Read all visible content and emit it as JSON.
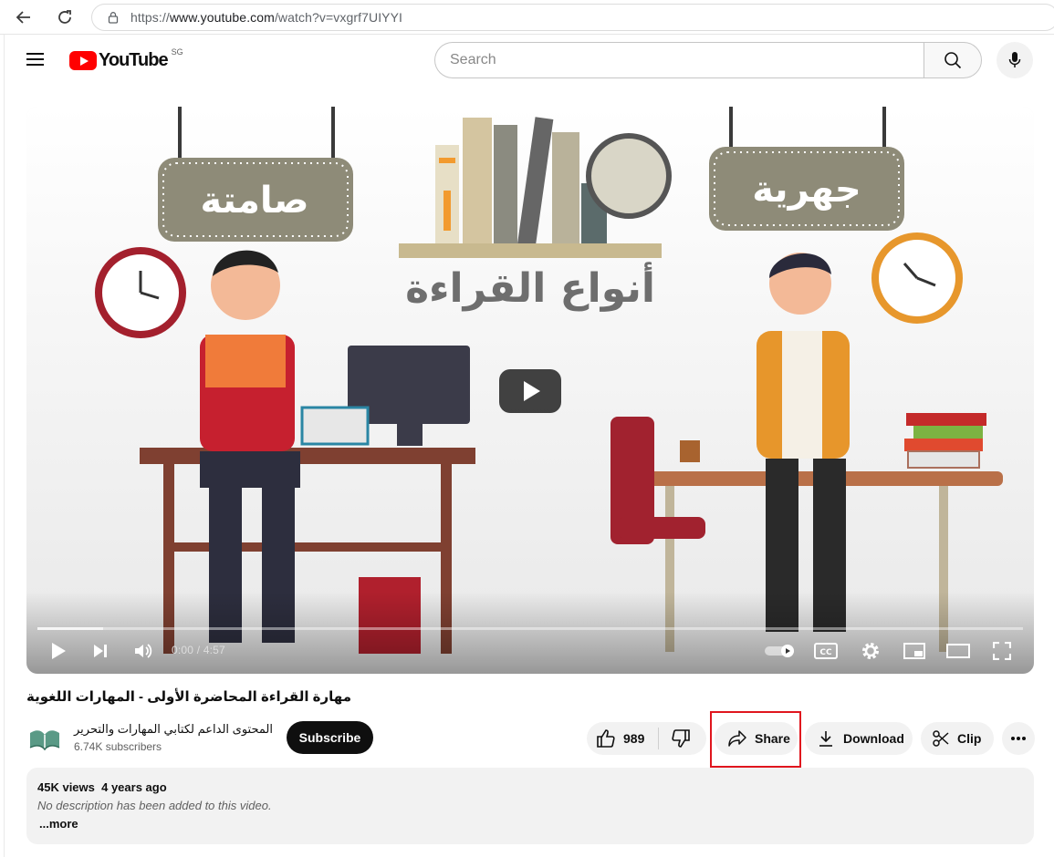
{
  "browser": {
    "url_prefix": "https://",
    "url_domain": "www.youtube.com",
    "url_path": "/watch?v=vxgrf7UIYYI",
    "icons": [
      "back-arrow-icon",
      "reload-icon",
      "lock-icon"
    ]
  },
  "header": {
    "logo_text": "YouTube",
    "country_code": "SG",
    "search_placeholder": "Search",
    "icons": [
      "menu-icon",
      "search-icon",
      "mic-icon"
    ],
    "brand_color": "#ff0000"
  },
  "player": {
    "thumbnail_text": {
      "left_sign": "صامتة",
      "right_sign": "جهرية",
      "center_title": "أنواع القراءة"
    },
    "time_current": "0:00",
    "time_separator": " / ",
    "time_total": "4:57",
    "loaded_fraction": 0.067,
    "icons": [
      "play-icon",
      "next-icon",
      "volume-icon",
      "autoplay-toggle-icon",
      "captions-icon",
      "settings-icon",
      "miniplayer-icon",
      "theater-icon",
      "fullscreen-icon"
    ]
  },
  "video": {
    "title": "مهارة القراءة المحاضرة الأولى - المهارات اللغوية"
  },
  "channel": {
    "name": "المحتوى الداعم لكتابي المهارات والتحرير",
    "subscribers": "6.74K subscribers",
    "subscribe_label": "Subscribe"
  },
  "actions": {
    "like_count": "989",
    "share_label": "Share",
    "download_label": "Download",
    "clip_label": "Clip",
    "highlight_color": "#e0161e"
  },
  "description": {
    "views": "45K views",
    "age": "4 years ago",
    "text": "No description has been added to this video.",
    "more_label": "...more"
  }
}
